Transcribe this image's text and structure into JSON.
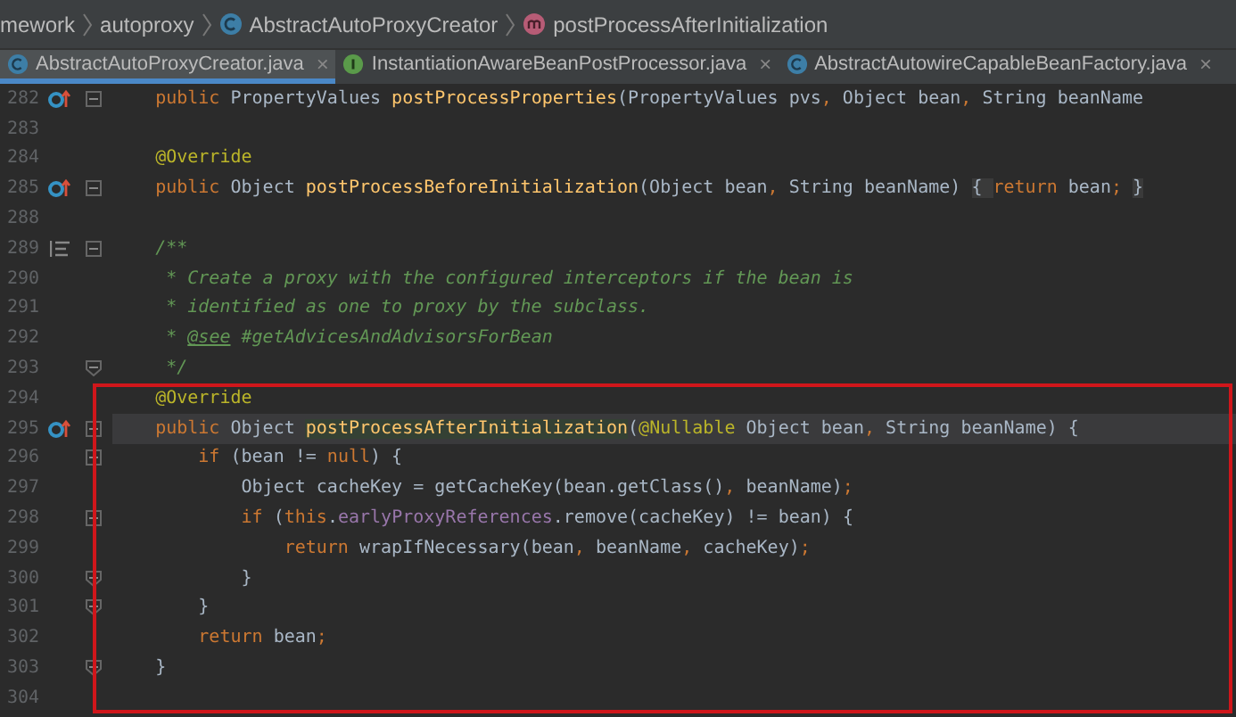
{
  "breadcrumbs": [
    {
      "label": "mework",
      "kind": "plain"
    },
    {
      "label": "autoproxy",
      "kind": "plain"
    },
    {
      "label": "AbstractAutoProxyCreator",
      "kind": "class"
    },
    {
      "label": "postProcessAfterInitialization",
      "kind": "method"
    }
  ],
  "tabs": [
    {
      "label": "AbstractAutoProxyCreator.java",
      "kind": "class",
      "selected": true,
      "close": "×"
    },
    {
      "label": "InstantiationAwareBeanPostProcessor.java",
      "kind": "interface",
      "selected": false,
      "close": "×"
    },
    {
      "label": "AbstractAutowireCapableBeanFactory.java",
      "kind": "class",
      "selected": false,
      "close": "×"
    }
  ],
  "lines": [
    {
      "number": "282",
      "current": false,
      "marks": [
        {
          "kind": "override"
        },
        {
          "kind": "foldstart"
        }
      ],
      "tokens": [
        {
          "text": "    public ",
          "kind": "keyword"
        },
        {
          "text": "PropertyValues ",
          "kind": "plain"
        },
        {
          "text": "postProcessProperties",
          "kind": "method"
        },
        {
          "text": "(PropertyValues pvs",
          "kind": "plain"
        },
        {
          "text": ", ",
          "kind": "keyword"
        },
        {
          "text": "Object bean",
          "kind": "plain"
        },
        {
          "text": ", ",
          "kind": "keyword"
        },
        {
          "text": "String beanName",
          "kind": "plain"
        }
      ]
    },
    {
      "number": "283",
      "current": false
    },
    {
      "number": "284",
      "current": false,
      "tokens": [
        {
          "text": "    @Override",
          "kind": "annotation"
        }
      ]
    },
    {
      "number": "285",
      "current": false,
      "marks": [
        {
          "kind": "override"
        },
        {
          "kind": "foldstart"
        }
      ],
      "tokens": [
        {
          "text": "    public ",
          "kind": "keyword"
        },
        {
          "text": "Object ",
          "kind": "plain"
        },
        {
          "text": "postProcessBeforeInitialization",
          "kind": "method"
        },
        {
          "text": "(Object bean",
          "kind": "plain"
        },
        {
          "text": ", ",
          "kind": "keyword"
        },
        {
          "text": "String beanName) ",
          "kind": "plain"
        },
        {
          "text": "{ ",
          "kind": "folded"
        },
        {
          "text": "return ",
          "kind": "keyword"
        },
        {
          "text": "bean",
          "kind": "plain"
        },
        {
          "text": "; ",
          "kind": "keyword"
        },
        {
          "text": "}",
          "kind": "folded"
        }
      ]
    },
    {
      "number": "288",
      "current": false
    },
    {
      "number": "289",
      "current": false,
      "marks": [
        {
          "kind": "doc"
        },
        {
          "kind": "foldstart"
        }
      ],
      "tokens": [
        {
          "text": "    /**",
          "kind": "comment"
        }
      ]
    },
    {
      "number": "290",
      "current": false,
      "tokens": [
        {
          "text": "     * Create a proxy with the configured interceptors if the bean is",
          "kind": "comment"
        }
      ]
    },
    {
      "number": "291",
      "current": false,
      "tokens": [
        {
          "text": "     * identified as one to proxy by the subclass.",
          "kind": "comment"
        }
      ]
    },
    {
      "number": "292",
      "current": false,
      "tokens": [
        {
          "text": "     * ",
          "kind": "comment"
        },
        {
          "text": "@see",
          "kind": "doctag"
        },
        {
          "text": " #getAdvicesAndAdvisorsForBean",
          "kind": "comment"
        }
      ]
    },
    {
      "number": "293",
      "current": false,
      "marks": [
        {
          "kind": "foldend"
        }
      ],
      "tokens": [
        {
          "text": "     */",
          "kind": "comment"
        }
      ]
    }
  ],
  "highlight_box": {
    "lines": [
      {
        "number": "294",
        "current": false,
        "tokens": [
          {
            "text": "    @Override",
            "kind": "annotation"
          }
        ]
      },
      {
        "number": "295",
        "current": true,
        "marks": [
          {
            "kind": "override"
          },
          {
            "kind": "foldstart"
          }
        ],
        "tokens": [
          {
            "text": "    public ",
            "kind": "keyword"
          },
          {
            "text": "Object ",
            "kind": "plain"
          },
          {
            "text": "postProcessAfterInitialization",
            "kind": "usage"
          },
          {
            "text": "(",
            "kind": "plain"
          },
          {
            "text": "@Nullable ",
            "kind": "annotation"
          },
          {
            "text": "Object bean",
            "kind": "plain"
          },
          {
            "text": ", ",
            "kind": "keyword"
          },
          {
            "text": "String beanName) {",
            "kind": "plain"
          }
        ]
      },
      {
        "number": "296",
        "current": false,
        "marks": [
          {
            "kind": "foldstart"
          }
        ],
        "tokens": [
          {
            "text": "        if ",
            "kind": "keyword"
          },
          {
            "text": "(bean != ",
            "kind": "plain"
          },
          {
            "text": "null",
            "kind": "keyword"
          },
          {
            "text": ") {",
            "kind": "plain"
          }
        ]
      },
      {
        "number": "297",
        "current": false,
        "tokens": [
          {
            "text": "            Object cacheKey = getCacheKey(bean.getClass()",
            "kind": "plain"
          },
          {
            "text": ", ",
            "kind": "keyword"
          },
          {
            "text": "beanName)",
            "kind": "plain"
          },
          {
            "text": ";",
            "kind": "keyword"
          }
        ]
      },
      {
        "number": "298",
        "current": false,
        "marks": [
          {
            "kind": "foldstart"
          }
        ],
        "tokens": [
          {
            "text": "            if ",
            "kind": "keyword"
          },
          {
            "text": "(",
            "kind": "plain"
          },
          {
            "text": "this",
            "kind": "keyword"
          },
          {
            "text": ".",
            "kind": "plain"
          },
          {
            "text": "earlyProxyReferences",
            "kind": "field"
          },
          {
            "text": ".remove(cacheKey) != bean) {",
            "kind": "plain"
          }
        ]
      },
      {
        "number": "299",
        "current": false,
        "tokens": [
          {
            "text": "                return ",
            "kind": "keyword"
          },
          {
            "text": "wrapIfNecessary(bean",
            "kind": "plain"
          },
          {
            "text": ", ",
            "kind": "keyword"
          },
          {
            "text": "beanName",
            "kind": "plain"
          },
          {
            "text": ", ",
            "kind": "keyword"
          },
          {
            "text": "cacheKey)",
            "kind": "plain"
          },
          {
            "text": ";",
            "kind": "keyword"
          }
        ]
      },
      {
        "number": "300",
        "current": false,
        "marks": [
          {
            "kind": "foldend"
          }
        ],
        "tokens": [
          {
            "text": "            }",
            "kind": "plain"
          }
        ]
      },
      {
        "number": "301",
        "current": false,
        "marks": [
          {
            "kind": "foldend"
          }
        ],
        "tokens": [
          {
            "text": "        }",
            "kind": "plain"
          }
        ]
      },
      {
        "number": "302",
        "current": false,
        "tokens": [
          {
            "text": "        return ",
            "kind": "keyword"
          },
          {
            "text": "bean",
            "kind": "plain"
          },
          {
            "text": ";",
            "kind": "keyword"
          }
        ]
      },
      {
        "number": "303",
        "current": false,
        "marks": [
          {
            "kind": "foldend"
          }
        ],
        "tokens": [
          {
            "text": "    }",
            "kind": "plain"
          }
        ]
      },
      {
        "number": "304",
        "current": false
      }
    ]
  }
}
